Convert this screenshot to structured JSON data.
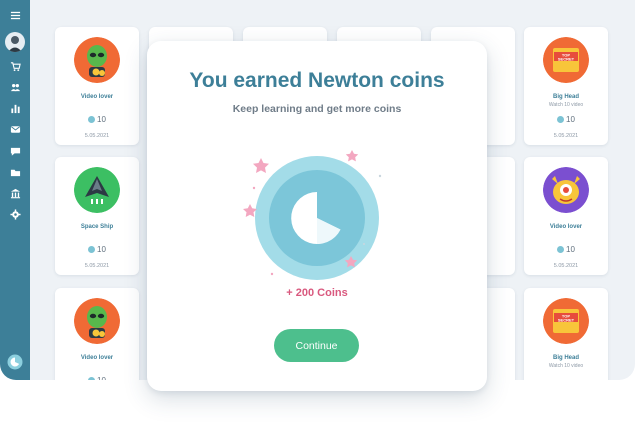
{
  "sidebar": {
    "icons": [
      "menu-icon",
      "cart-icon",
      "group-icon",
      "bar-chart-icon",
      "mail-icon",
      "chat-icon",
      "folder-icon",
      "building-icon",
      "gear-icon"
    ],
    "bottom_icon": "newton-logo-icon",
    "accent": "#3d7f98"
  },
  "cards": [
    {
      "badge": "alien",
      "title": "Video lover",
      "subtitle": "",
      "coins": "10",
      "date": "5.05.2021"
    },
    {
      "badge": "hidden",
      "title": "",
      "subtitle": "",
      "coins": "",
      "date": ""
    },
    {
      "badge": "hidden",
      "title": "",
      "subtitle": "",
      "coins": "",
      "date": ""
    },
    {
      "badge": "hidden",
      "title": "",
      "subtitle": "",
      "coins": "",
      "date": ""
    },
    {
      "badge": "hidden",
      "title": "",
      "subtitle": "",
      "coins": "",
      "date": ""
    },
    {
      "badge": "top-secret",
      "title": "Big Head",
      "subtitle": "Watch 10 video",
      "coins": "10",
      "date": "5.05.2021"
    },
    {
      "badge": "spaceship",
      "title": "Space Ship",
      "subtitle": "",
      "coins": "10",
      "date": "5.05.2021"
    },
    {
      "badge": "hidden",
      "title": "",
      "subtitle": "",
      "coins": "",
      "date": ""
    },
    {
      "badge": "hidden",
      "title": "",
      "subtitle": "",
      "coins": "",
      "date": ""
    },
    {
      "badge": "hidden",
      "title": "",
      "subtitle": "",
      "coins": "",
      "date": ""
    },
    {
      "badge": "hidden",
      "title": "",
      "subtitle": "",
      "coins": "",
      "date": ""
    },
    {
      "badge": "cyclops",
      "title": "Video lover",
      "subtitle": "",
      "coins": "10",
      "date": "5.05.2021"
    },
    {
      "badge": "alien",
      "title": "Video lover",
      "subtitle": "",
      "coins": "10",
      "date": ""
    },
    {
      "badge": "hidden",
      "title": "",
      "subtitle": "",
      "coins": "",
      "date": ""
    },
    {
      "badge": "hidden",
      "title": "",
      "subtitle": "",
      "coins": "",
      "date": ""
    },
    {
      "badge": "hidden",
      "title": "",
      "subtitle": "",
      "coins": "",
      "date": ""
    },
    {
      "badge": "hidden",
      "title": "",
      "subtitle": "",
      "coins": "",
      "date": ""
    },
    {
      "badge": "top-secret",
      "title": "Big Head",
      "subtitle": "Watch 10 video",
      "coins": "",
      "date": ""
    }
  ],
  "modal": {
    "title": "You earned  Newton coins",
    "subtitle": "Keep learning and get more coins",
    "earned": "+ 200 Coins",
    "continue_label": "Continue",
    "coin_icon": "newton-coin-icon"
  },
  "colors": {
    "primary": "#3d7f98",
    "earned": "#d9587e",
    "button": "#4dbf8d"
  }
}
